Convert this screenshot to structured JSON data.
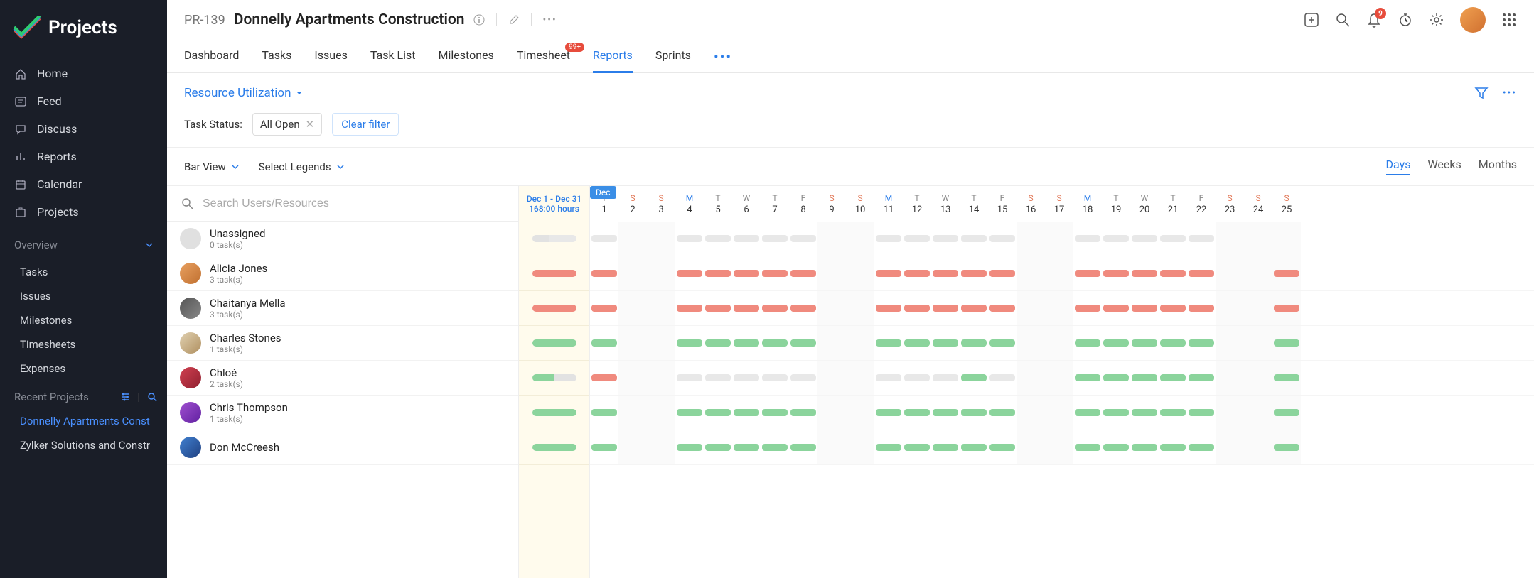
{
  "app": {
    "name": "Projects"
  },
  "sidebar": {
    "nav": [
      {
        "label": "Home",
        "icon": "home-icon"
      },
      {
        "label": "Feed",
        "icon": "feed-icon"
      },
      {
        "label": "Discuss",
        "icon": "discuss-icon"
      },
      {
        "label": "Reports",
        "icon": "reports-icon"
      },
      {
        "label": "Calendar",
        "icon": "calendar-icon"
      },
      {
        "label": "Projects",
        "icon": "projects-icon"
      }
    ],
    "overview_label": "Overview",
    "overview_items": [
      "Tasks",
      "Issues",
      "Milestones",
      "Timesheets",
      "Expenses"
    ],
    "recent_label": "Recent Projects",
    "recent": [
      {
        "label": "Donnelly Apartments Const",
        "active": true
      },
      {
        "label": "Zylker Solutions and Constr",
        "active": false
      }
    ]
  },
  "header": {
    "prefix": "PR-139",
    "title": "Donnelly Apartments Construction",
    "notification_count": "9",
    "tabs": [
      "Dashboard",
      "Tasks",
      "Issues",
      "Task List",
      "Milestones",
      "Timesheet",
      "Reports",
      "Sprints"
    ],
    "active_tab": 6,
    "timesheet_badge": "99+"
  },
  "report": {
    "dropdown_label": "Resource Utilization",
    "filter_label": "Task Status:",
    "filter_value": "All Open",
    "clear_filter": "Clear filter",
    "bar_view": "Bar View",
    "legends": "Select Legends",
    "scale": [
      "Days",
      "Weeks",
      "Months"
    ],
    "active_scale": 0,
    "search_placeholder": "Search Users/Resources"
  },
  "summary": {
    "range": "Dec 1 - Dec 31",
    "hours": "168:00 hours",
    "month_pill": "Dec"
  },
  "days": [
    {
      "wd": "T",
      "n": "1",
      "type": "today"
    },
    {
      "wd": "S",
      "n": "2",
      "type": "weekend"
    },
    {
      "wd": "S",
      "n": "3",
      "type": "weekend"
    },
    {
      "wd": "M",
      "n": "4",
      "type": "mon"
    },
    {
      "wd": "T",
      "n": "5",
      "type": ""
    },
    {
      "wd": "W",
      "n": "6",
      "type": ""
    },
    {
      "wd": "T",
      "n": "7",
      "type": ""
    },
    {
      "wd": "F",
      "n": "8",
      "type": ""
    },
    {
      "wd": "S",
      "n": "9",
      "type": "weekend"
    },
    {
      "wd": "S",
      "n": "10",
      "type": "weekend"
    },
    {
      "wd": "M",
      "n": "11",
      "type": "mon"
    },
    {
      "wd": "T",
      "n": "12",
      "type": ""
    },
    {
      "wd": "W",
      "n": "13",
      "type": ""
    },
    {
      "wd": "T",
      "n": "14",
      "type": ""
    },
    {
      "wd": "F",
      "n": "15",
      "type": ""
    },
    {
      "wd": "S",
      "n": "16",
      "type": "weekend"
    },
    {
      "wd": "S",
      "n": "17",
      "type": "weekend"
    },
    {
      "wd": "M",
      "n": "18",
      "type": "mon"
    },
    {
      "wd": "T",
      "n": "19",
      "type": ""
    },
    {
      "wd": "W",
      "n": "20",
      "type": ""
    },
    {
      "wd": "T",
      "n": "21",
      "type": ""
    },
    {
      "wd": "F",
      "n": "22",
      "type": ""
    },
    {
      "wd": "S",
      "n": "23",
      "type": "weekend"
    },
    {
      "wd": "S",
      "n": "24",
      "type": "weekend"
    },
    {
      "wd": "S",
      "n": "25",
      "type": "weekend"
    }
  ],
  "resources": [
    {
      "name": "Unassigned",
      "tasks": "0 task(s)",
      "av": 0,
      "summary": [
        [
          "grey",
          40
        ]
      ],
      "cells": [
        "grey",
        "",
        "",
        "grey",
        "grey",
        "grey",
        "grey",
        "grey",
        "",
        "",
        "grey",
        "grey",
        "grey",
        "grey",
        "grey",
        "",
        "",
        "grey",
        "grey",
        "grey",
        "grey",
        "grey",
        "",
        "",
        ""
      ]
    },
    {
      "name": "Alicia Jones",
      "tasks": "3 task(s)",
      "av": 1,
      "summary": [
        [
          "red",
          100
        ]
      ],
      "cells": [
        "red",
        "",
        "",
        "red",
        "red",
        "red",
        "red",
        "red",
        "",
        "",
        "red",
        "red",
        "red",
        "red",
        "red",
        "",
        "",
        "red",
        "red",
        "red",
        "red",
        "red",
        "",
        "",
        "red"
      ]
    },
    {
      "name": "Chaitanya Mella",
      "tasks": "3 task(s)",
      "av": 2,
      "summary": [
        [
          "red",
          100
        ]
      ],
      "cells": [
        "red",
        "",
        "",
        "red",
        "red",
        "red",
        "red",
        "red",
        "",
        "",
        "red",
        "red",
        "red",
        "red",
        "red",
        "",
        "",
        "red",
        "red",
        "red",
        "red",
        "red",
        "",
        "",
        "red"
      ]
    },
    {
      "name": "Charles Stones",
      "tasks": "1 task(s)",
      "av": 3,
      "summary": [
        [
          "green",
          100
        ]
      ],
      "cells": [
        "green",
        "",
        "",
        "green",
        "green",
        "green",
        "green",
        "green",
        "",
        "",
        "green",
        "green",
        "green",
        "green",
        "green",
        "",
        "",
        "green",
        "green",
        "green",
        "green",
        "green",
        "",
        "",
        "green"
      ]
    },
    {
      "name": "Chloé",
      "tasks": "2 task(s)",
      "av": 4,
      "summary": [
        [
          "green",
          50
        ],
        [
          "grey",
          50
        ]
      ],
      "cells": [
        "red",
        "",
        "",
        "grey",
        "grey",
        "grey",
        "grey",
        "grey",
        "",
        "",
        "grey",
        "grey",
        "grey",
        "green",
        "grey",
        "",
        "",
        "green",
        "green",
        "green",
        "green",
        "green",
        "",
        "",
        "green"
      ]
    },
    {
      "name": "Chris Thompson",
      "tasks": "1 task(s)",
      "av": 5,
      "summary": [
        [
          "green",
          100
        ]
      ],
      "cells": [
        "green",
        "",
        "",
        "green",
        "green",
        "green",
        "green",
        "green",
        "",
        "",
        "green",
        "green",
        "green",
        "green",
        "green",
        "",
        "",
        "green",
        "green",
        "green",
        "green",
        "green",
        "",
        "",
        "green"
      ]
    },
    {
      "name": "Don McCreesh",
      "tasks": "",
      "av": 6,
      "summary": [
        [
          "green",
          100
        ]
      ],
      "cells": [
        "green",
        "",
        "",
        "green",
        "green",
        "green",
        "green",
        "green",
        "",
        "",
        "green",
        "green",
        "green",
        "green",
        "green",
        "",
        "",
        "green",
        "green",
        "green",
        "green",
        "green",
        "",
        "",
        "green"
      ]
    }
  ]
}
